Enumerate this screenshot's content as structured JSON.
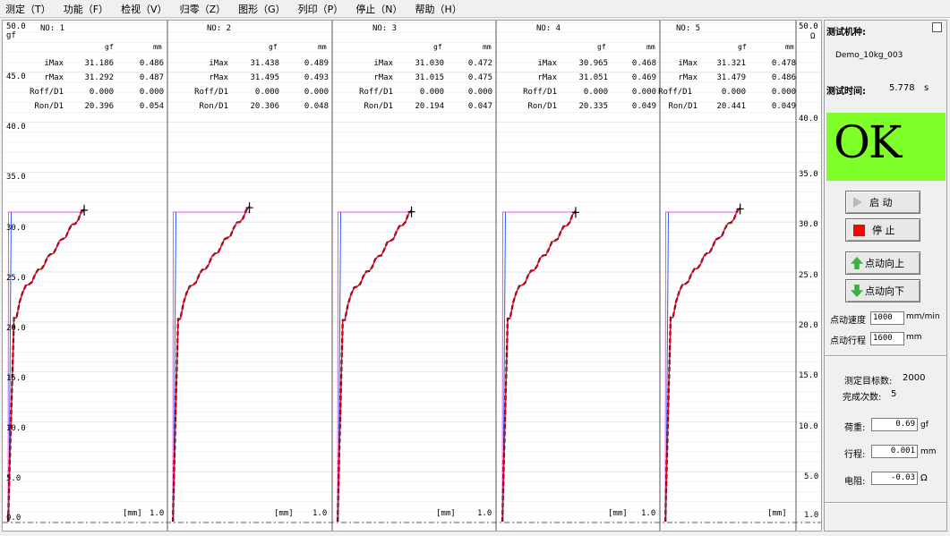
{
  "menu": [
    "测定（T）",
    "功能（F）",
    "检视（V）",
    "归零（Z）",
    "图形（G）",
    "列印（P）",
    "停止（N）",
    "帮助（H）"
  ],
  "axis": {
    "left_ticks": [
      "50.0",
      "45.0",
      "40.0",
      "35.0",
      "30.0",
      "25.0",
      "20.0",
      "15.0",
      "10.0",
      "5.0",
      "0.0"
    ],
    "right_ticks": [
      "50.0",
      "40.0",
      "35.0",
      "30.0",
      "25.0",
      "20.0",
      "15.0",
      "10.0",
      "5.0",
      "1.0"
    ],
    "left_unit": "gf",
    "right_unit": "Ω",
    "x_unit": "[mm]",
    "x_max": "1.0"
  },
  "table_headers": {
    "gf": "gf",
    "mm": "mm"
  },
  "row_names": [
    "iMax",
    "rMax",
    "Roff/D1",
    "Ron/D1"
  ],
  "panels": [
    {
      "no": "NO: 1",
      "rows": [
        [
          "31.186",
          "0.486"
        ],
        [
          "31.292",
          "0.487"
        ],
        [
          "0.000",
          "0.000"
        ],
        [
          "20.396",
          "0.054"
        ]
      ]
    },
    {
      "no": "NO: 2",
      "rows": [
        [
          "31.438",
          "0.489"
        ],
        [
          "31.495",
          "0.493"
        ],
        [
          "0.000",
          "0.000"
        ],
        [
          "20.306",
          "0.048"
        ]
      ]
    },
    {
      "no": "NO: 3",
      "rows": [
        [
          "31.030",
          "0.472"
        ],
        [
          "31.015",
          "0.475"
        ],
        [
          "0.000",
          "0.000"
        ],
        [
          "20.194",
          "0.047"
        ]
      ]
    },
    {
      "no": "NO: 4",
      "rows": [
        [
          "30.965",
          "0.468"
        ],
        [
          "31.051",
          "0.469"
        ],
        [
          "0.000",
          "0.000"
        ],
        [
          "20.335",
          "0.049"
        ]
      ]
    },
    {
      "no": "NO: 5",
      "rows": [
        [
          "31.321",
          "0.478"
        ],
        [
          "31.479",
          "0.486"
        ],
        [
          "0.000",
          "0.000"
        ],
        [
          "20.441",
          "0.049"
        ]
      ]
    }
  ],
  "chart_data": {
    "type": "line",
    "x_unit": "mm",
    "y_unit": "gf",
    "xlim": [
      0,
      1.0
    ],
    "ylim": [
      0,
      50
    ],
    "series": [
      {
        "panel": 1,
        "peak_x": 0.486,
        "peak_y": 31.19,
        "knee_x": 0.054,
        "knee_y": 20.4
      },
      {
        "panel": 2,
        "peak_x": 0.489,
        "peak_y": 31.44,
        "knee_x": 0.048,
        "knee_y": 20.3
      },
      {
        "panel": 3,
        "peak_x": 0.472,
        "peak_y": 31.03,
        "knee_x": 0.047,
        "knee_y": 20.19
      },
      {
        "panel": 4,
        "peak_x": 0.468,
        "peak_y": 30.97,
        "knee_x": 0.049,
        "knee_y": 20.34
      },
      {
        "panel": 5,
        "peak_x": 0.478,
        "peak_y": 31.32,
        "knee_x": 0.049,
        "knee_y": 20.44
      }
    ],
    "colors": {
      "force": "#e8001c",
      "force_dark": "#000000",
      "threshold": "#ff44ff",
      "resistance": "#3355ff",
      "grid": "#e2e2e2"
    }
  },
  "side": {
    "machine_label": "测试机种:",
    "machine_value": "Demo_10kg_003",
    "time_label": "测试时间:",
    "time_value": "5.778",
    "time_unit": "s",
    "result": "OK",
    "result_color": "#7fff2a",
    "btn_start": "启 动",
    "btn_stop": "停 止",
    "btn_up": "点动向上",
    "btn_down": "点动向下",
    "speed_label": "点动速度",
    "speed_value": "1000",
    "speed_unit": "mm/min",
    "stroke_label": "点动行程",
    "stroke_value": "1600",
    "stroke_unit": "mm",
    "target_label": "测定目标数:",
    "target_value": "2000",
    "done_label": "完成次数:",
    "done_value": "5",
    "load_label": "荷重:",
    "load_value": "0.69",
    "load_unit": "gf",
    "travel_label": "行程:",
    "travel_value": "0.001",
    "travel_unit": "mm",
    "res_label": "电阻:",
    "res_value": "-0.03",
    "res_unit": "Ω"
  }
}
